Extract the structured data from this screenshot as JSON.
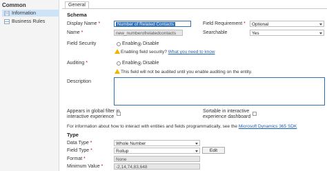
{
  "sidebar": {
    "title": "Common",
    "items": [
      {
        "label": "Information",
        "icon": "document-icon"
      },
      {
        "label": "Business Rules",
        "icon": "rules-icon"
      }
    ]
  },
  "tabs": {
    "general": "General"
  },
  "schema": {
    "heading": "Schema",
    "display_name_label": "Display Name",
    "display_name_value": "Number of Related Contacts",
    "name_label": "Name",
    "name_value": "new_numberofrelatedcontacts",
    "field_requirement_label": "Field Requirement",
    "field_requirement_value": "Optional",
    "searchable_label": "Searchable",
    "searchable_value": "Yes",
    "field_security_label": "Field Security",
    "enable_label": "Enable",
    "disable_label": "Disable",
    "security_warning": "Enabling field security?",
    "security_link": "What you need to know",
    "auditing_label": "Auditing",
    "auditing_warning": "This field will not be audited until you enable auditing on the entity.",
    "description_label": "Description",
    "appears_label_1": "Appears in global filter in",
    "appears_label_2": "interactive experience",
    "sortable_label_1": "Sortable in interactive",
    "sortable_label_2": "experience dashboard",
    "info_text": "For information about how to interact with entities and fields programmatically, see the",
    "sdk_link": "Microsoft Dynamics 365 SDK"
  },
  "type": {
    "heading": "Type",
    "data_type_label": "Data Type",
    "data_type_value": "Whole Number",
    "field_type_label": "Field Type",
    "field_type_value": "Rollup",
    "edit_label": "Edit",
    "format_label": "Format",
    "format_value": "None",
    "minimum_value_label": "Minimum Value",
    "minimum_value_value": "-2,14,74,83,648"
  },
  "colors": {
    "accent": "#2f6fb8",
    "required": "#cc0000",
    "warning": "#f0b400"
  }
}
